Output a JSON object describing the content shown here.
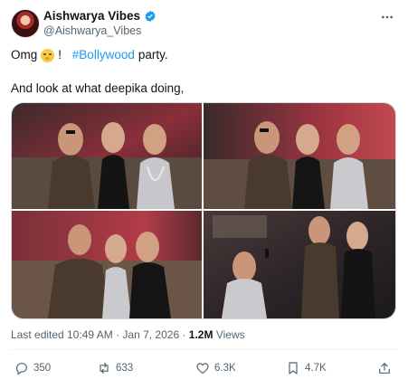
{
  "author": {
    "display_name": "Aishwarya Vibes",
    "handle": "@Aishwarya_Vibes",
    "verified_color": "#1d9bf0"
  },
  "tweet": {
    "line1_prefix": "Omg",
    "line1_bang": "!",
    "hashtag": "#Bollywood",
    "line1_suffix": "party.",
    "line2": "And look at what deepika  doing,"
  },
  "icons": {
    "more": "more-icon",
    "reply": "reply-icon",
    "repost": "repost-icon",
    "like": "heart-icon",
    "views": "views-icon",
    "share": "share-icon",
    "emoji": "shushing-face-emoji"
  },
  "meta": {
    "edited_time": "Last edited 10:49 AM · Jan 7, 2026 · ",
    "views": "1.2M",
    "views_label": " Views"
  },
  "actions": {
    "replies": "350",
    "reposts": "633",
    "likes": "6.3K",
    "views": "4.7K"
  },
  "colors": {
    "text": "#0f1419",
    "secondary": "#536471",
    "accent": "#1d9bf0",
    "border": "#cfd9de"
  }
}
